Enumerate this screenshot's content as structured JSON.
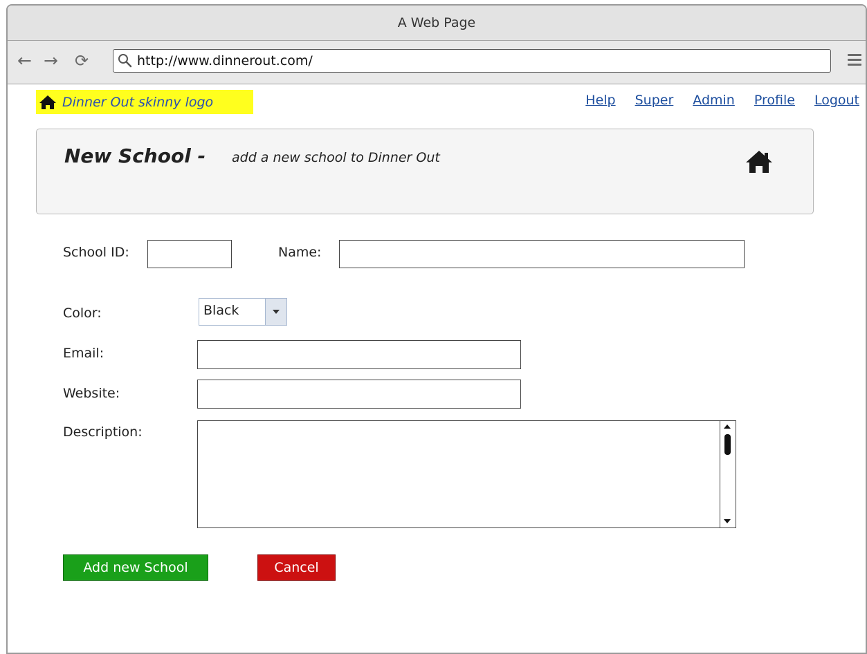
{
  "window": {
    "title": "A Web Page"
  },
  "browser": {
    "url": "http://www.dinnerout.com/",
    "back_icon": "arrow-left-icon",
    "forward_icon": "arrow-right-icon",
    "reload_icon": "reload-icon",
    "menu_icon": "hamburger-menu-icon"
  },
  "logo": {
    "text": "Dinner Out skinny logo",
    "highlight_color": "#ffff1e"
  },
  "topnav": {
    "help": "Help",
    "super": "Super",
    "admin": "Admin",
    "profile": "Profile",
    "logout": "Logout"
  },
  "header": {
    "title": "New School -",
    "subtitle": "add a new school to Dinner Out"
  },
  "form": {
    "school_id_label": "School ID:",
    "school_id_value": "",
    "name_label": "Name:",
    "name_value": "",
    "color_label": "Color:",
    "color_value": "Black",
    "email_label": "Email:",
    "email_value": "",
    "website_label": "Website:",
    "website_value": "",
    "description_label": "Description:",
    "description_value": ""
  },
  "buttons": {
    "add_label": "Add new School",
    "add_color": "#1aa01a",
    "cancel_label": "Cancel",
    "cancel_color": "#cc1111"
  }
}
